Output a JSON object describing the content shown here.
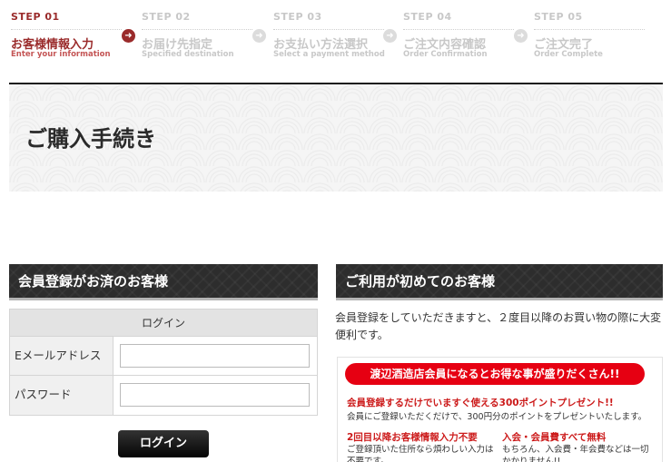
{
  "steps": [
    {
      "num": "STEP 01",
      "jp": "お客様情報入力",
      "en": "Enter your information",
      "active": true
    },
    {
      "num": "STEP 02",
      "jp": "お届け先指定",
      "en": "Specified destination",
      "active": false
    },
    {
      "num": "STEP 03",
      "jp": "お支払い方法選択",
      "en": "Select a payment method",
      "active": false
    },
    {
      "num": "STEP 04",
      "jp": "ご注文内容確認",
      "en": "Order Confirmation",
      "active": false
    },
    {
      "num": "STEP 05",
      "jp": "ご注文完了",
      "en": "Order Complete",
      "active": false
    }
  ],
  "arrow_icon": "arrow-right-circle-icon",
  "page_title": "ご購入手続き",
  "member_section": {
    "title": "会員登録がお済のお客様",
    "table_header": "ログイン",
    "email_label": "Eメールアドレス",
    "email_value": "",
    "password_label": "パスワード",
    "password_value": "",
    "login_button": "ログイン"
  },
  "new_section": {
    "title": "ご利用が初めてのお客様",
    "intro": "会員登録をしていただきますと、２度目以降のお買い物の際に大変便利です。",
    "benefit_title": "渡辺酒造店会員になるとお得な事が盛りだくさん!!",
    "benefit1_head": "会員登録するだけでいますぐ使える300ポイントプレゼント!!",
    "benefit1_text": "会員にご登録いただくだけで、300円分のポイントをプレゼントいたします。",
    "benefit2_head": "2回目以降お客様情報入力不要",
    "benefit2_text": "ご登録頂いた住所なら煩わしい入力は不要です。",
    "benefit3_head": "入会・会員費すべて無料",
    "benefit3_text": "もちろん、入会費・年会費などは一切かかりません!!"
  },
  "colors": {
    "accent": "#9a2b2b",
    "inactive": "#c8c8c8",
    "header_bg": "#2d2d2d",
    "banner_red": "#e60012"
  }
}
